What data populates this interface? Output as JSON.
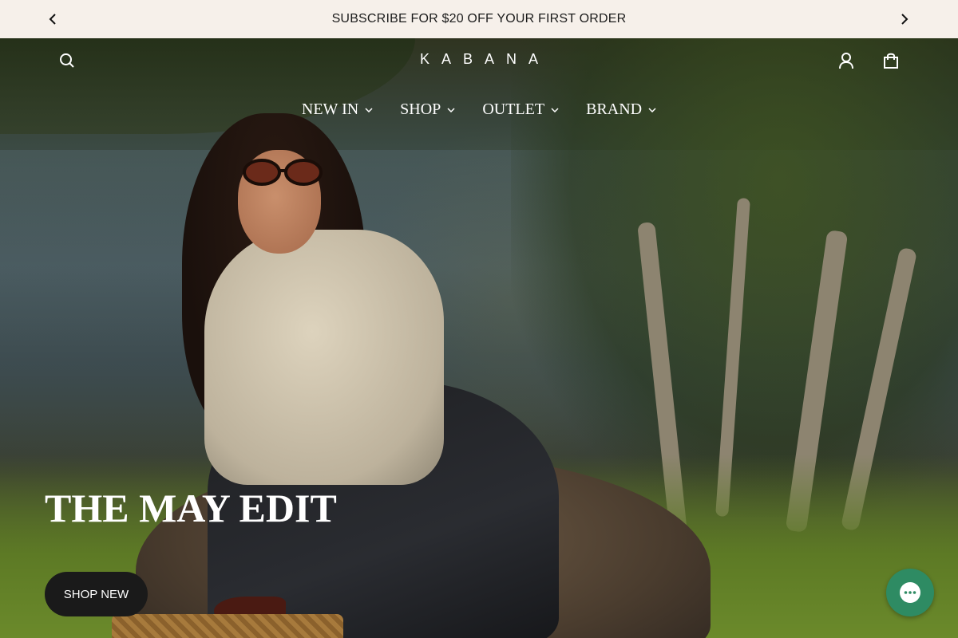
{
  "announcement": {
    "text": "SUBSCRIBE FOR $20 OFF YOUR FIRST ORDER",
    "prev_icon": "chevron-left-icon",
    "next_icon": "chevron-right-icon"
  },
  "header": {
    "logo": "KABANA",
    "search_icon": "search-icon",
    "account_icon": "user-icon",
    "cart_icon": "shopping-bag-icon"
  },
  "nav": {
    "items": [
      {
        "label": "NEW IN"
      },
      {
        "label": "SHOP"
      },
      {
        "label": "OUTLET"
      },
      {
        "label": "BRAND"
      }
    ]
  },
  "hero": {
    "title": "THE MAY EDIT",
    "cta_label": "SHOP NEW"
  },
  "chat": {
    "icon": "chat-bubble-icon",
    "color": "#2e8b63"
  },
  "colors": {
    "announcement_bg": "#f6f0ea",
    "button_bg": "#1a1a1a"
  }
}
